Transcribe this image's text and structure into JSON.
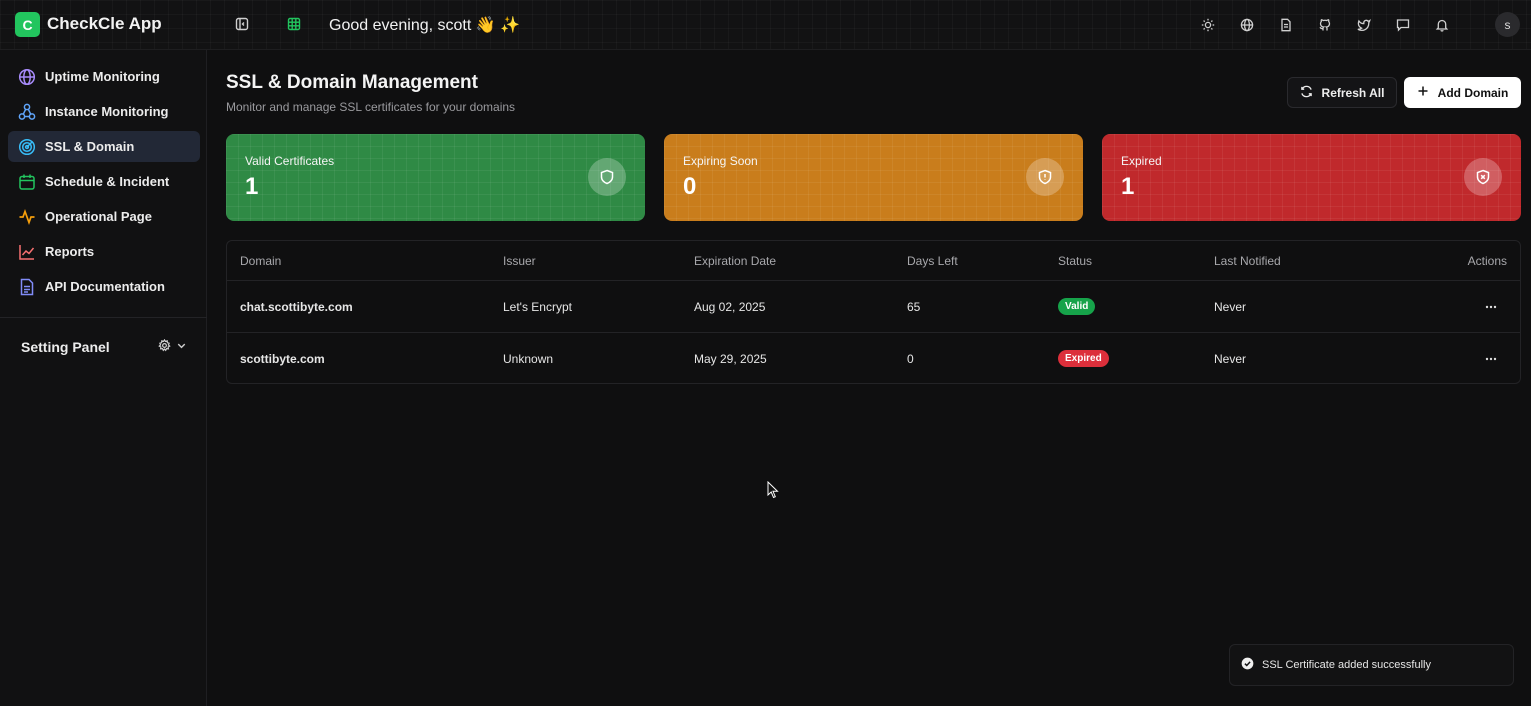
{
  "header": {
    "logo_letter": "C",
    "app_title": "CheckCle App",
    "greeting": "Good evening, scott 👋 ✨",
    "avatar_letter": "s",
    "icons": [
      "sun-icon",
      "globe-icon",
      "document-icon",
      "github-icon",
      "twitter-icon",
      "chat-icon",
      "bell-icon"
    ]
  },
  "sidebar": {
    "items": [
      {
        "label": "Uptime Monitoring",
        "icon": "globe-icon",
        "color": "#a78bfa"
      },
      {
        "label": "Instance Monitoring",
        "icon": "network-icon",
        "color": "#60a5fa"
      },
      {
        "label": "SSL & Domain",
        "icon": "radar-icon",
        "color": "#38bdf8",
        "active": true
      },
      {
        "label": "Schedule & Incident",
        "icon": "calendar-icon",
        "color": "#22c55e"
      },
      {
        "label": "Operational Page",
        "icon": "activity-icon",
        "color": "#f59e0b"
      },
      {
        "label": "Reports",
        "icon": "chart-icon",
        "color": "#f87171"
      },
      {
        "label": "API Documentation",
        "icon": "doc-icon",
        "color": "#818cf8"
      }
    ],
    "setting_panel": "Setting Panel"
  },
  "main": {
    "title": "SSL & Domain Management",
    "subtitle": "Monitor and manage SSL certificates for your domains",
    "refresh_label": "Refresh All",
    "add_label": "Add Domain",
    "cards": [
      {
        "label": "Valid Certificates",
        "value": "1",
        "color": "#2f8a45"
      },
      {
        "label": "Expiring Soon",
        "value": "0",
        "color": "#c97d1c"
      },
      {
        "label": "Expired",
        "value": "1",
        "color": "#c0292c"
      }
    ],
    "table": {
      "headers": [
        "Domain",
        "Issuer",
        "Expiration Date",
        "Days Left",
        "Status",
        "Last Notified",
        "Actions"
      ],
      "rows": [
        {
          "domain": "chat.scottibyte.com",
          "issuer": "Let's Encrypt",
          "expiration": "Aug 02, 2025",
          "days_left": "65",
          "status": "Valid",
          "last_notified": "Never"
        },
        {
          "domain": "scottibyte.com",
          "issuer": "Unknown",
          "expiration": "May 29, 2025",
          "days_left": "0",
          "status": "Expired",
          "last_notified": "Never"
        }
      ]
    }
  },
  "toast": {
    "message": "SSL Certificate added successfully"
  }
}
